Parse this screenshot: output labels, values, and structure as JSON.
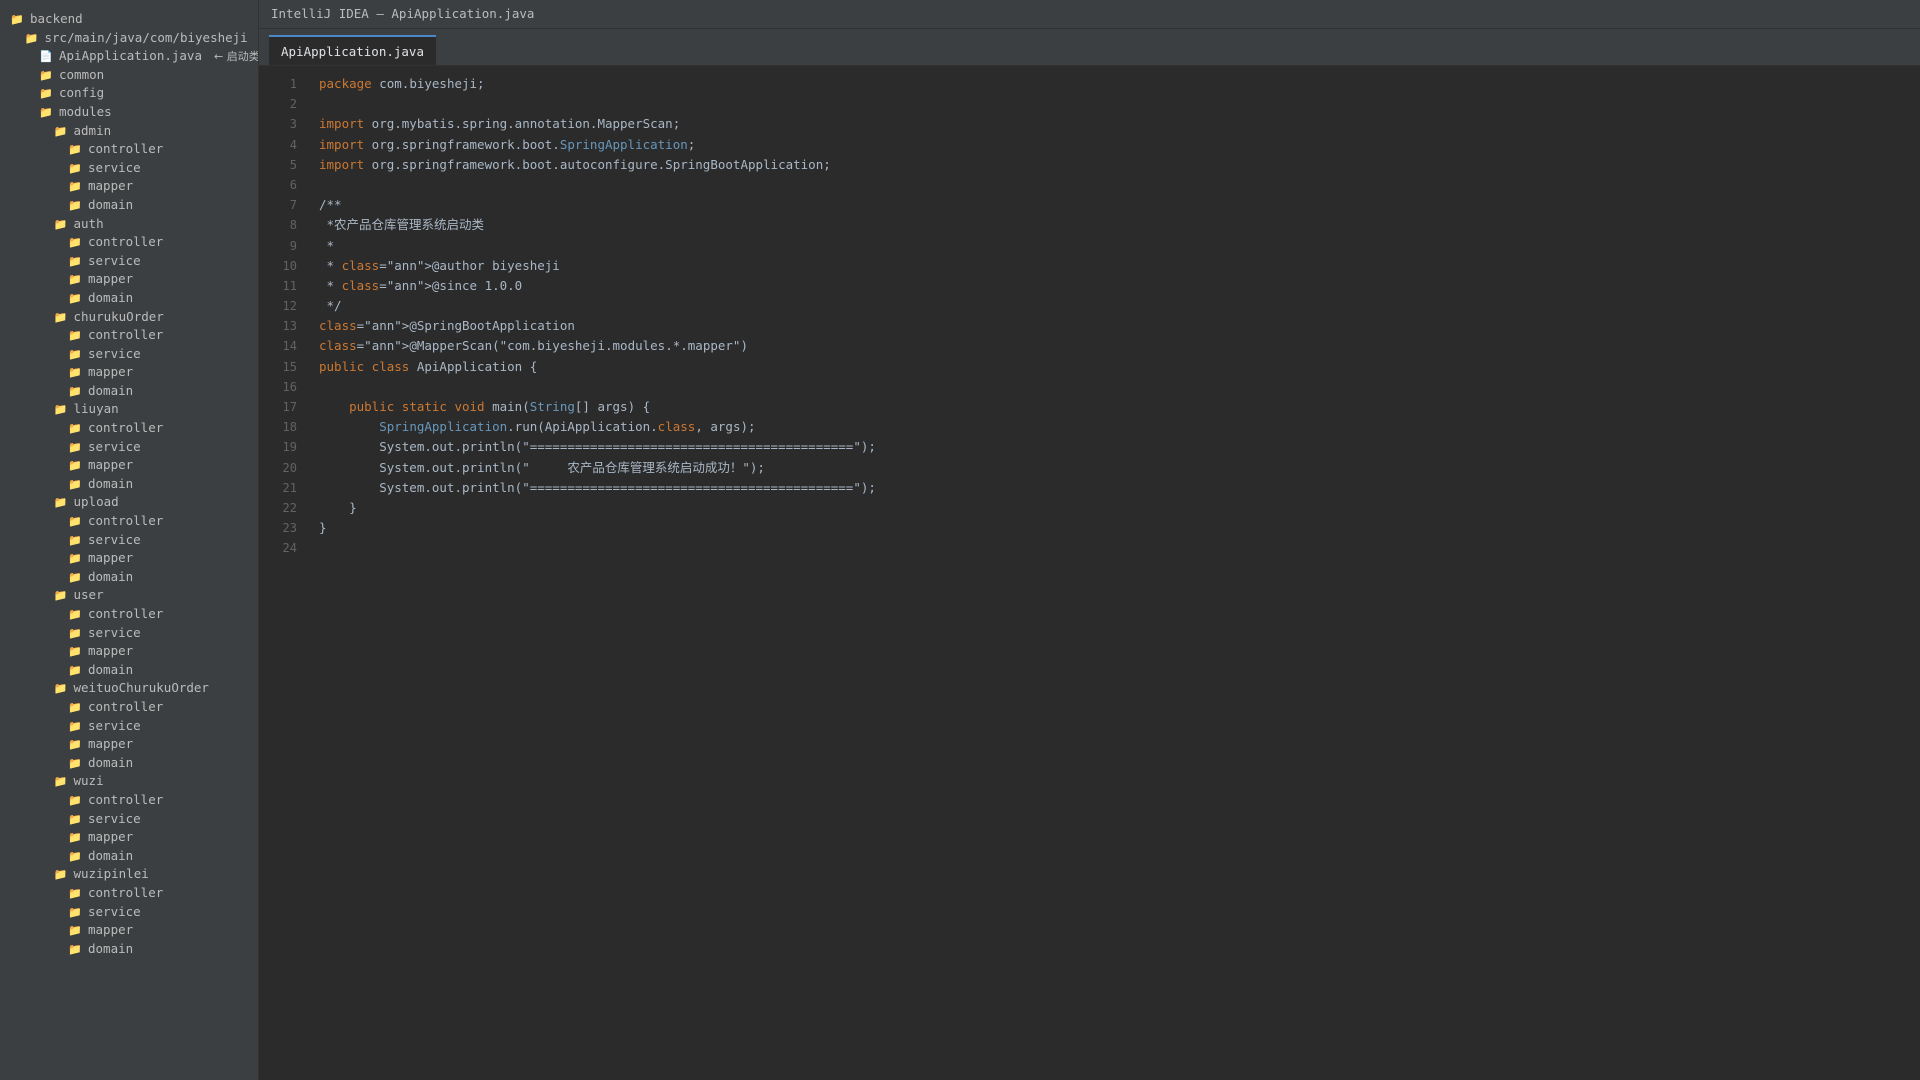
{
  "window": {
    "title": "IntelliJ IDEA — ApiApplication.java"
  },
  "tabs": [
    {
      "label": "ApiApplication.java"
    }
  ],
  "colors": {
    "keyword": "#cc7832",
    "type": "#6897bb",
    "plain": "#a9b7c6",
    "folder": "#e8bf6a",
    "accent": "#4a88c7"
  },
  "tree": [
    {
      "label": "backend",
      "icon": "folder-icon",
      "depth": 0
    },
    {
      "label": "src/main/java/com/biyesheji",
      "icon": "folder-icon",
      "depth": 1
    },
    {
      "label": "ApiApplication.java",
      "icon": "file-icon",
      "depth": 2,
      "note": "← 启动类"
    },
    {
      "label": "common",
      "icon": "folder-icon",
      "depth": 2
    },
    {
      "label": "config",
      "icon": "folder-icon",
      "depth": 2
    },
    {
      "label": "modules",
      "icon": "folder-icon",
      "depth": 2
    },
    {
      "label": "admin",
      "icon": "folder-icon",
      "depth": 3
    },
    {
      "label": "controller",
      "icon": "folder-icon",
      "depth": 4
    },
    {
      "label": "service",
      "icon": "folder-icon",
      "depth": 4
    },
    {
      "label": "mapper",
      "icon": "folder-icon",
      "depth": 4
    },
    {
      "label": "domain",
      "icon": "folder-icon",
      "depth": 4
    },
    {
      "label": "auth",
      "icon": "folder-icon",
      "depth": 3
    },
    {
      "label": "controller",
      "icon": "folder-icon",
      "depth": 4
    },
    {
      "label": "service",
      "icon": "folder-icon",
      "depth": 4
    },
    {
      "label": "mapper",
      "icon": "folder-icon",
      "depth": 4
    },
    {
      "label": "domain",
      "icon": "folder-icon",
      "depth": 4
    },
    {
      "label": "churukuOrder",
      "icon": "folder-icon",
      "depth": 3
    },
    {
      "label": "controller",
      "icon": "folder-icon",
      "depth": 4
    },
    {
      "label": "service",
      "icon": "folder-icon",
      "depth": 4
    },
    {
      "label": "mapper",
      "icon": "folder-icon",
      "depth": 4
    },
    {
      "label": "domain",
      "icon": "folder-icon",
      "depth": 4
    },
    {
      "label": "liuyan",
      "icon": "folder-icon",
      "depth": 3
    },
    {
      "label": "controller",
      "icon": "folder-icon",
      "depth": 4
    },
    {
      "label": "service",
      "icon": "folder-icon",
      "depth": 4
    },
    {
      "label": "mapper",
      "icon": "folder-icon",
      "depth": 4
    },
    {
      "label": "domain",
      "icon": "folder-icon",
      "depth": 4
    },
    {
      "label": "upload",
      "icon": "folder-icon",
      "depth": 3
    },
    {
      "label": "controller",
      "icon": "folder-icon",
      "depth": 4
    },
    {
      "label": "service",
      "icon": "folder-icon",
      "depth": 4
    },
    {
      "label": "mapper",
      "icon": "folder-icon",
      "depth": 4
    },
    {
      "label": "domain",
      "icon": "folder-icon",
      "depth": 4
    },
    {
      "label": "user",
      "icon": "folder-icon",
      "depth": 3
    },
    {
      "label": "controller",
      "icon": "folder-icon",
      "depth": 4
    },
    {
      "label": "service",
      "icon": "folder-icon",
      "depth": 4
    },
    {
      "label": "mapper",
      "icon": "folder-icon",
      "depth": 4
    },
    {
      "label": "domain",
      "icon": "folder-icon",
      "depth": 4
    },
    {
      "label": "weituoChurukuOrder",
      "icon": "folder-icon",
      "depth": 3
    },
    {
      "label": "controller",
      "icon": "folder-icon",
      "depth": 4
    },
    {
      "label": "service",
      "icon": "folder-icon",
      "depth": 4
    },
    {
      "label": "mapper",
      "icon": "folder-icon",
      "depth": 4
    },
    {
      "label": "domain",
      "icon": "folder-icon",
      "depth": 4
    },
    {
      "label": "wuzi",
      "icon": "folder-icon",
      "depth": 3
    },
    {
      "label": "controller",
      "icon": "folder-icon",
      "depth": 4
    },
    {
      "label": "service",
      "icon": "folder-icon",
      "depth": 4
    },
    {
      "label": "mapper",
      "icon": "folder-icon",
      "depth": 4
    },
    {
      "label": "domain",
      "icon": "folder-icon",
      "depth": 4
    },
    {
      "label": "wuzipinlei",
      "icon": "folder-icon",
      "depth": 3
    },
    {
      "label": "controller",
      "icon": "folder-icon",
      "depth": 4
    },
    {
      "label": "service",
      "icon": "folder-icon",
      "depth": 4
    },
    {
      "label": "mapper",
      "icon": "folder-icon",
      "depth": 4
    },
    {
      "label": "domain",
      "icon": "folder-icon",
      "depth": 4
    }
  ],
  "code_lines": [
    {
      "n": "1",
      "tokens": [
        [
          "kw",
          "package"
        ],
        [
          "pl",
          " com.biyesheji;"
        ]
      ]
    },
    {
      "n": "2",
      "tokens": []
    },
    {
      "n": "3",
      "tokens": [
        [
          "kw",
          "import"
        ],
        [
          "pl",
          " org.mybatis.spring.annotation.MapperScan;"
        ]
      ]
    },
    {
      "n": "4",
      "tokens": [
        [
          "kw",
          "import"
        ],
        [
          "pl",
          " org.springframework.boot."
        ],
        [
          "ty",
          "SpringApplication"
        ],
        [
          "pl",
          ";"
        ]
      ]
    },
    {
      "n": "5",
      "tokens": [
        [
          "kw",
          "import"
        ],
        [
          "pl",
          " org.springframework.boot.autoconfigure.SpringBootApplication;"
        ]
      ]
    },
    {
      "n": "6",
      "tokens": []
    },
    {
      "n": "7",
      "tokens": [
        [
          "cm",
          "/**"
        ]
      ]
    },
    {
      "n": "8",
      "tokens": [
        [
          "cm",
          " *农产品仓库管理系统启动类"
        ]
      ]
    },
    {
      "n": "9",
      "tokens": [
        [
          "cm",
          " *"
        ]
      ]
    },
    {
      "n": "10",
      "tokens": [
        [
          "cm",
          " * "
        ],
        [
          "kw",
          "class"
        ],
        [
          "pl",
          "=\"ann\">@author biyesheji"
        ]
      ]
    },
    {
      "n": "11",
      "tokens": [
        [
          "cm",
          " * "
        ],
        [
          "kw",
          "class"
        ],
        [
          "pl",
          "=\"ann\">@since 1.0.0"
        ]
      ]
    },
    {
      "n": "12",
      "tokens": [
        [
          "cm",
          " */"
        ]
      ]
    },
    {
      "n": "13",
      "tokens": [
        [
          "kw",
          "class"
        ],
        [
          "pl",
          "=\"ann\">@SpringBootApplication"
        ]
      ]
    },
    {
      "n": "14",
      "tokens": [
        [
          "kw",
          "class"
        ],
        [
          "pl",
          "=\"ann\">@MapperScan(\"com.biyesheji.modules.*.mapper\")"
        ]
      ]
    },
    {
      "n": "15",
      "tokens": [
        [
          "kw",
          "public class"
        ],
        [
          "pl",
          " ApiApplication {"
        ]
      ]
    },
    {
      "n": "16",
      "tokens": []
    },
    {
      "n": "17",
      "tokens": [
        [
          "pl",
          "    "
        ],
        [
          "kw",
          "public static void"
        ],
        [
          "pl",
          " main("
        ],
        [
          "ty",
          "String"
        ],
        [
          "pl",
          "[] args) {"
        ]
      ]
    },
    {
      "n": "18",
      "tokens": [
        [
          "pl",
          "        "
        ],
        [
          "ty",
          "SpringApplication"
        ],
        [
          "pl",
          ".run(ApiApplication."
        ],
        [
          "kw",
          "class"
        ],
        [
          "pl",
          ", args);"
        ]
      ]
    },
    {
      "n": "19",
      "tokens": [
        [
          "pl",
          "        System.out.println(\"===========================================\");"
        ]
      ]
    },
    {
      "n": "20",
      "tokens": [
        [
          "pl",
          "        System.out.println(\"     农产品仓库管理系统启动成功！\");"
        ]
      ]
    },
    {
      "n": "21",
      "tokens": [
        [
          "pl",
          "        System.out.println(\"===========================================\");"
        ]
      ]
    },
    {
      "n": "22",
      "tokens": [
        [
          "pl",
          "    }"
        ]
      ]
    },
    {
      "n": "23",
      "tokens": [
        [
          "pl",
          "}"
        ]
      ]
    },
    {
      "n": "24",
      "tokens": []
    }
  ]
}
